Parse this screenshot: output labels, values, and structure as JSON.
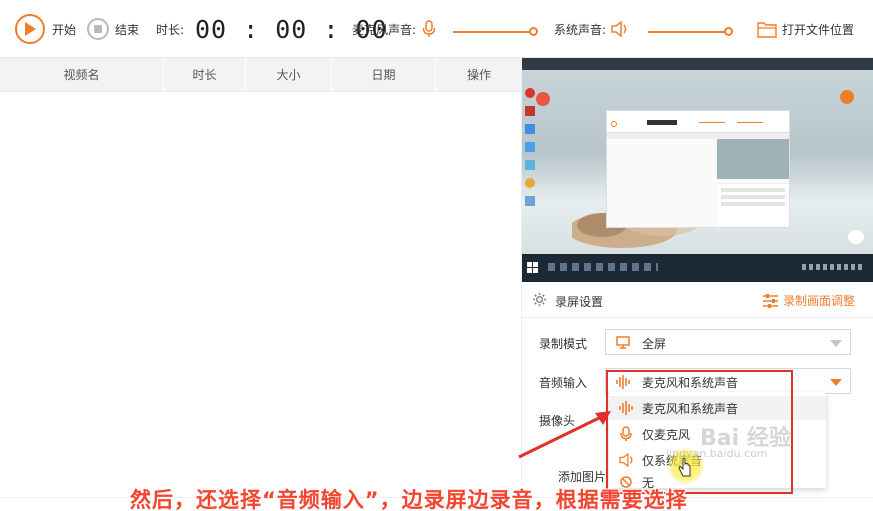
{
  "toolbar": {
    "start_label": "开始",
    "stop_label": "结束",
    "duration_label": "时长:",
    "timer": "00 : 00 : 00",
    "mic_label": "麦克风声音:",
    "system_label": "系统声音:",
    "open_folder_label": "打开文件位置",
    "accent_color": "#f07d2c"
  },
  "table": {
    "columns": [
      "视频名",
      "时长",
      "大小",
      "日期",
      "操作"
    ]
  },
  "settings": {
    "title": "录屏设置",
    "adjust_label": "录制画面调整",
    "mode_label": "录制模式",
    "mode_value": "全屏",
    "audio_label": "音频输入",
    "audio_value": "麦克风和系统声音",
    "camera_label": "摄像头",
    "add_image_label": "添加图片"
  },
  "audio_options": [
    "麦克风和系统声音",
    "仅麦克风",
    "仅系统声音",
    "无"
  ],
  "caption": "然后，还选择“音频输入”，边录屏边录音，根据需要选择",
  "watermark": {
    "main": "Bai 经验",
    "sub": "jingyan.baidu.com"
  }
}
